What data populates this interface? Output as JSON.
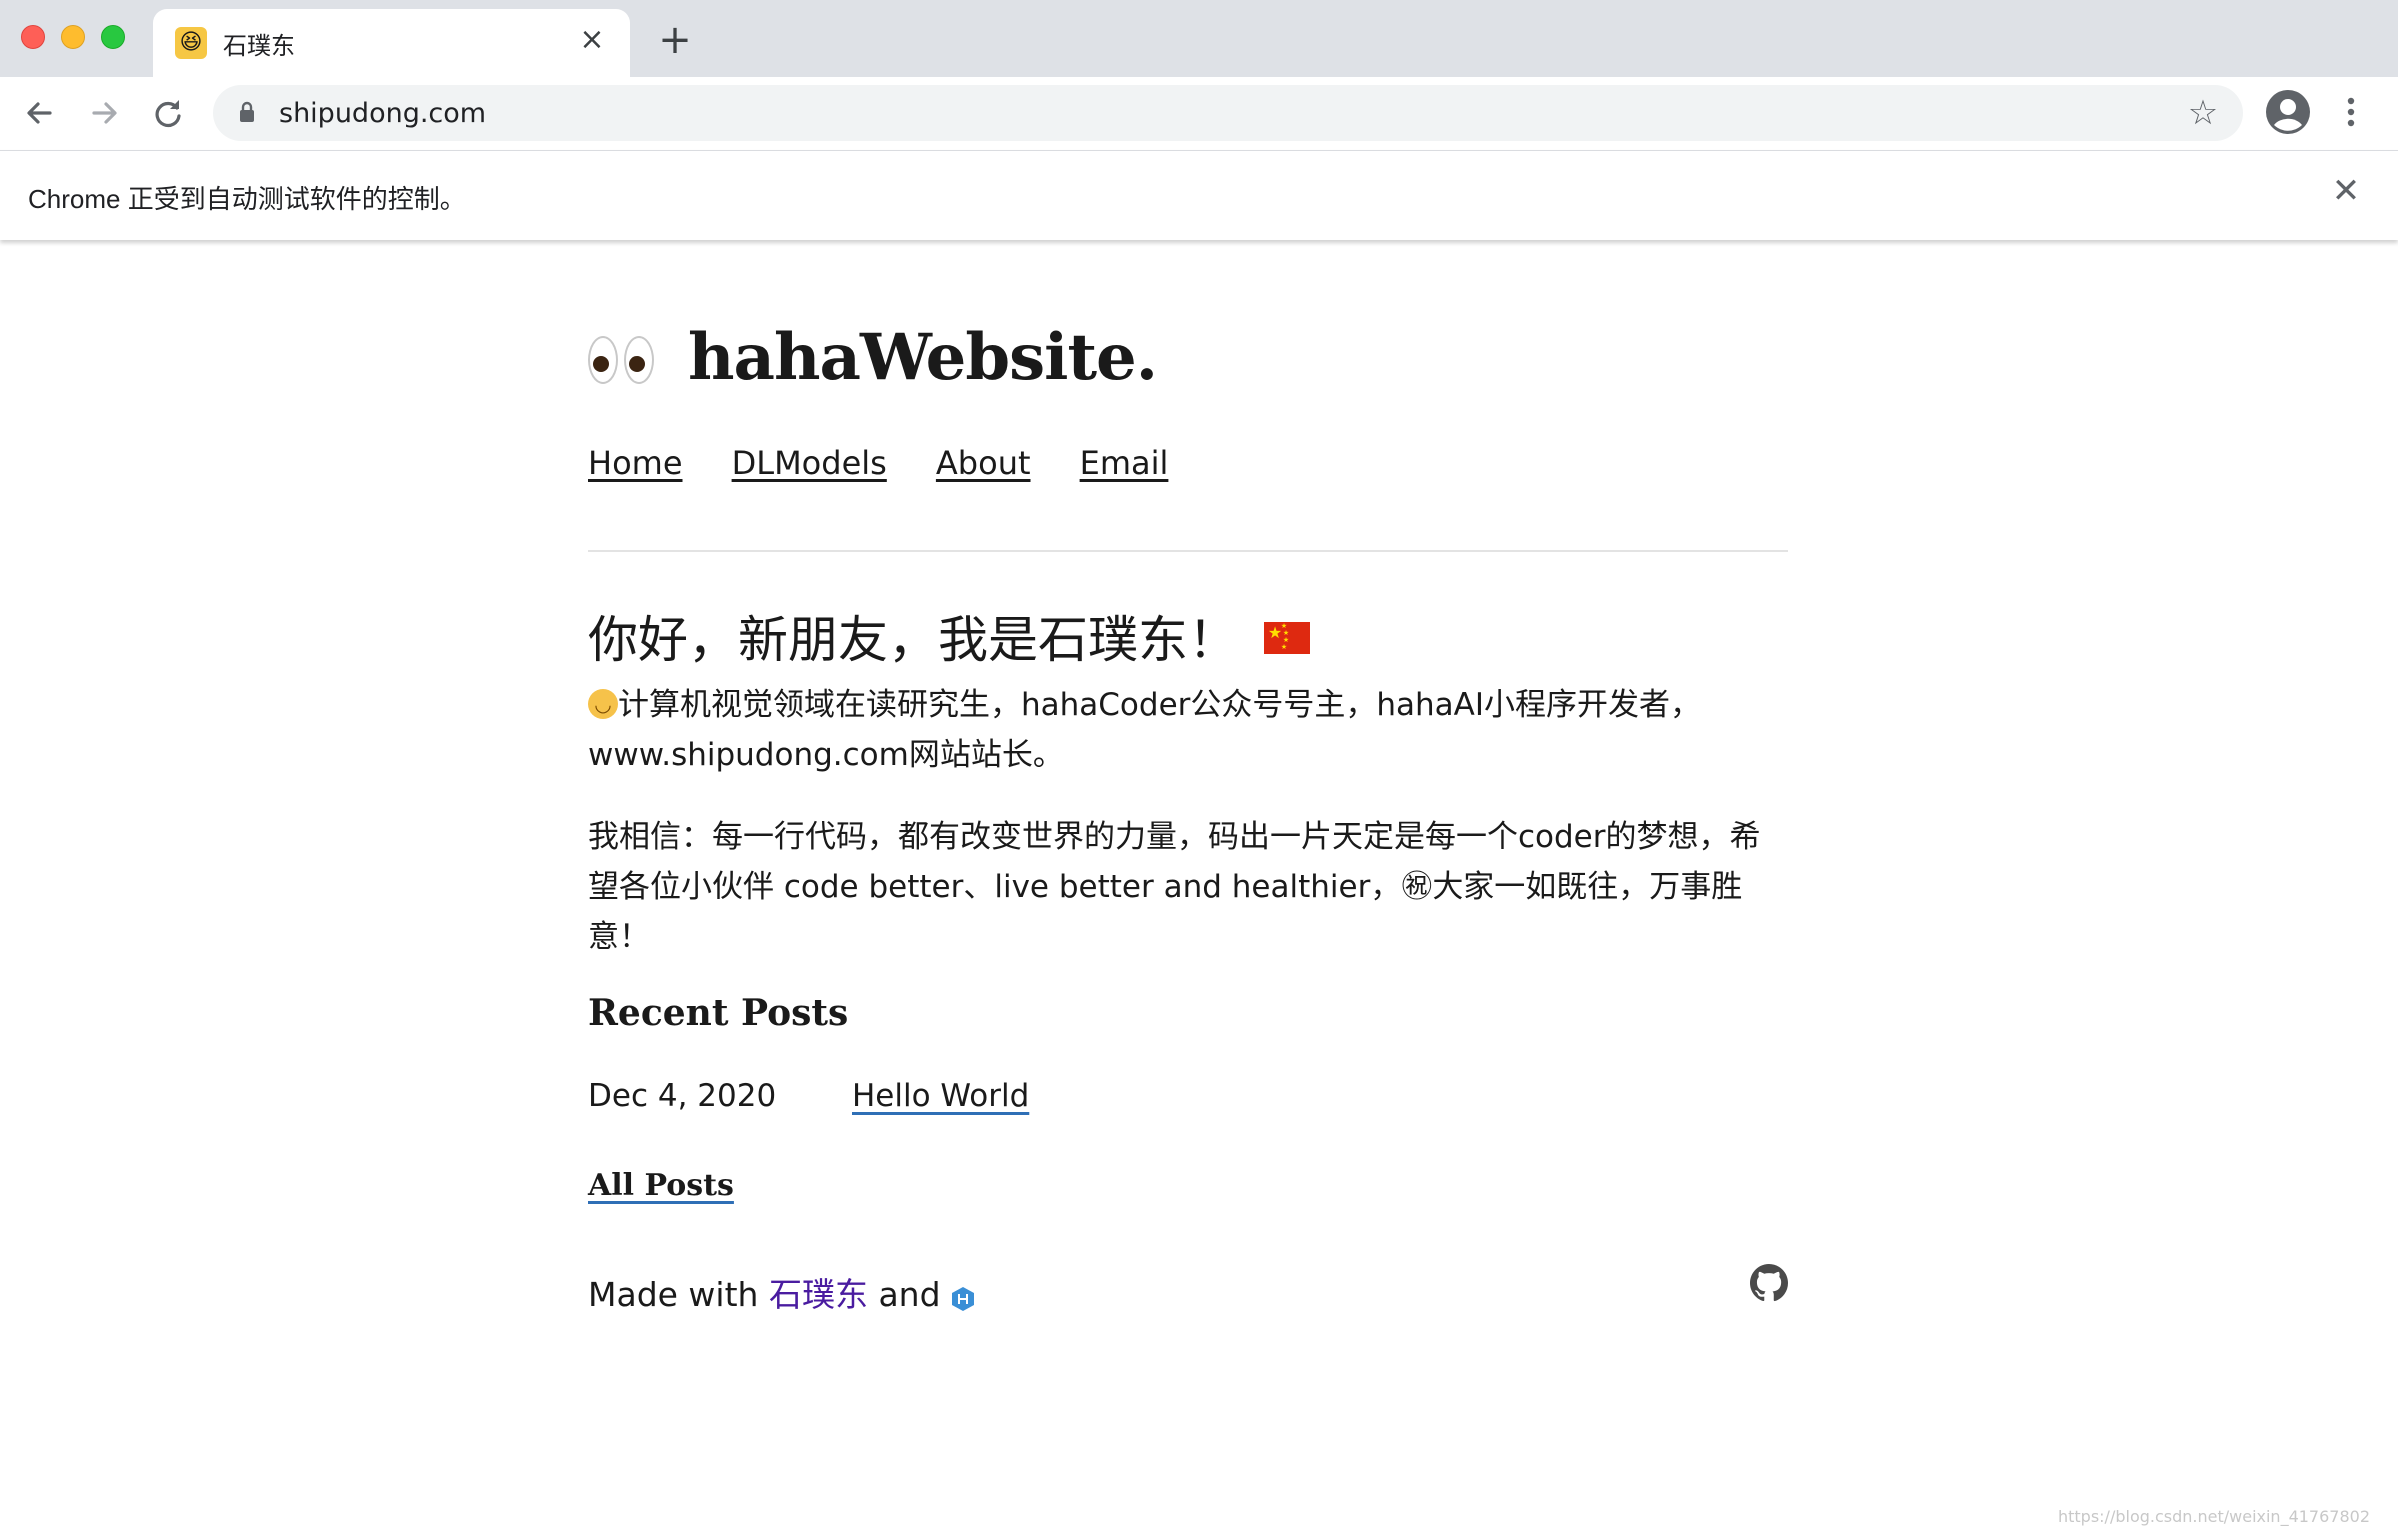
{
  "browser": {
    "tab": {
      "title": "石璞东",
      "favicon": "laughing-face-icon"
    },
    "url": "shipudong.com",
    "infobar": {
      "message": "Chrome 正受到自动测试软件的控制。"
    }
  },
  "site": {
    "title": "hahaWebsite.",
    "nav": [
      "Home",
      "DLModels",
      "About",
      "Email"
    ],
    "greeting": "你好，新朋友，我是石璞东！",
    "intro": "计算机视觉领域在读研究生，hahaCoder公众号号主，hahaAI小程序开发者，www.shipudong.com网站站长。",
    "belief_before": "我相信：每一行代码，都有改变世界的力量，码出一片天定是每一个coder的梦想，希望各位小伙伴 code better、live better and healthier，",
    "belief_symbol": "㊗",
    "belief_after": "大家一如既往，万事胜意！",
    "recent_posts_title": "Recent Posts",
    "posts": [
      {
        "date": "Dec 4, 2020",
        "title": "Hello World"
      }
    ],
    "all_posts_label": "All Posts",
    "footer": {
      "prefix": "Made with",
      "author": "石璞东",
      "connector": "and"
    }
  },
  "watermark": "https://blog.csdn.net/weixin_41767802",
  "colors": {
    "author_link": "#4a1ca0",
    "underline": "#2f6fb6",
    "flag_red": "#de2910",
    "flag_star": "#ffde00"
  }
}
